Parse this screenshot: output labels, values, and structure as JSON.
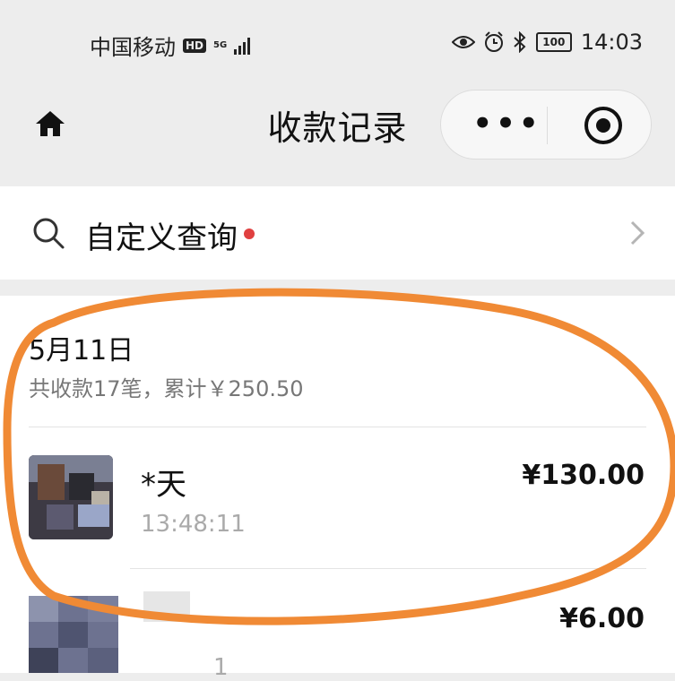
{
  "status_bar": {
    "carrier": "中国移动",
    "hd": "HD",
    "network": "5G",
    "battery": "100",
    "time": "14:03"
  },
  "nav": {
    "title": "收款记录",
    "more_label": "•••"
  },
  "query": {
    "label": "自定义查询"
  },
  "records": {
    "date": "5月11日",
    "summary": "共收款17笔，累计￥250.50",
    "items": [
      {
        "name": "*天",
        "time": "13:48:11",
        "amount": "¥130.00"
      },
      {
        "name": "",
        "time": "1",
        "amount": "¥6.00"
      }
    ]
  },
  "colors": {
    "background": "#ededed",
    "annotation": "#f08a35",
    "dot": "#e04040"
  }
}
